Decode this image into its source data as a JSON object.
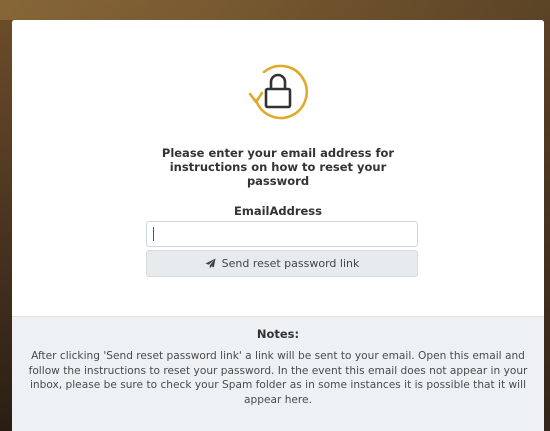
{
  "reset": {
    "instructions": "Please enter your email address for instructions on how to reset your password",
    "email_label": "EmailAddress",
    "email_value": "",
    "email_placeholder": "",
    "send_label": "Send reset password link"
  },
  "notes": {
    "title": "Notes:",
    "body": "After clicking 'Send reset password link' a link will be sent to your email. Open this email and follow the instructions to reset your password. In the event this email does not appear in your inbox, please be sure to check your Spam folder as in some instances it is possible that it will appear here."
  },
  "icons": {
    "lock": "lock-reset-icon",
    "send": "paper-plane-icon"
  },
  "colors": {
    "accent": "#e0a92a",
    "lock_stroke": "#333333",
    "button_bg": "#e8ebee",
    "notes_bg": "#eef1f4"
  }
}
